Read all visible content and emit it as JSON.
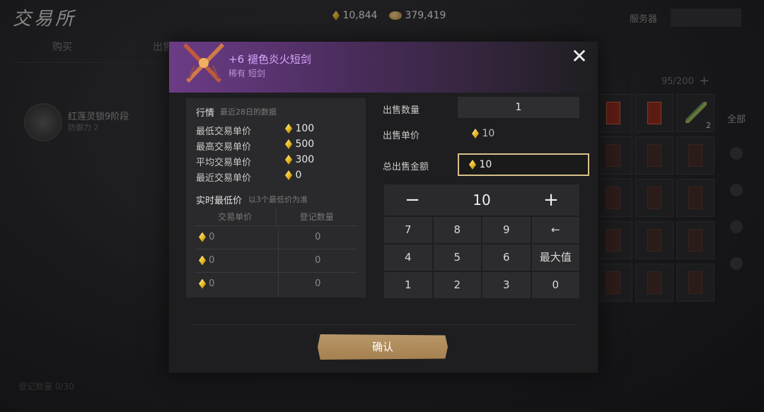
{
  "app": {
    "title": "交易所"
  },
  "currencies": [
    {
      "icon": "gem-icon",
      "value": "10,844"
    },
    {
      "icon": "coin-icon",
      "value": "379,419"
    }
  ],
  "server": {
    "label": "服务器",
    "button": ""
  },
  "bg_tabs": [
    "购买",
    "出售"
  ],
  "bg_list": {
    "title": "红莲灵锁9阶段",
    "sub": "防御力 2"
  },
  "bg_bottom": "登记数量 0/30",
  "inventory": {
    "count": "95/200",
    "badge_qty": "2",
    "filter_all": "全部"
  },
  "modal": {
    "item_name": "+6 褪色炎火短剑",
    "item_rarity": "稀有 短剑",
    "close": "✕",
    "market": {
      "title": "行情",
      "subtitle": "最近28日的数据",
      "rows": [
        {
          "label": "最低交易单价",
          "value": "100"
        },
        {
          "label": "最高交易单价",
          "value": "500"
        },
        {
          "label": "平均交易单价",
          "value": "300"
        },
        {
          "label": "最近交易单价",
          "value": "0"
        }
      ],
      "realtime_title": "实时最低价",
      "realtime_sub": "以3个最低价为准",
      "table_headers": [
        "交易单价",
        "登记数量"
      ],
      "table_rows": [
        {
          "price": "0",
          "qty": "0"
        },
        {
          "price": "0",
          "qty": "0"
        },
        {
          "price": "0",
          "qty": "0"
        }
      ]
    },
    "sell": {
      "qty_label": "出售数量",
      "qty_value": "1",
      "price_label": "出售单价",
      "price_value": "10",
      "total_label": "总出售金额",
      "total_value": "10"
    },
    "stepper": {
      "minus": "−",
      "value": "10",
      "plus": "+"
    },
    "keypad": [
      "7",
      "8",
      "9",
      "←",
      "4",
      "5",
      "6",
      "最大值",
      "1",
      "2",
      "3",
      "0"
    ],
    "confirm": "确认"
  },
  "colors": {
    "accent_gold": "#d7c08a",
    "rarity_purple": "#d8a8ff",
    "confirm_bg": "#b99768"
  }
}
